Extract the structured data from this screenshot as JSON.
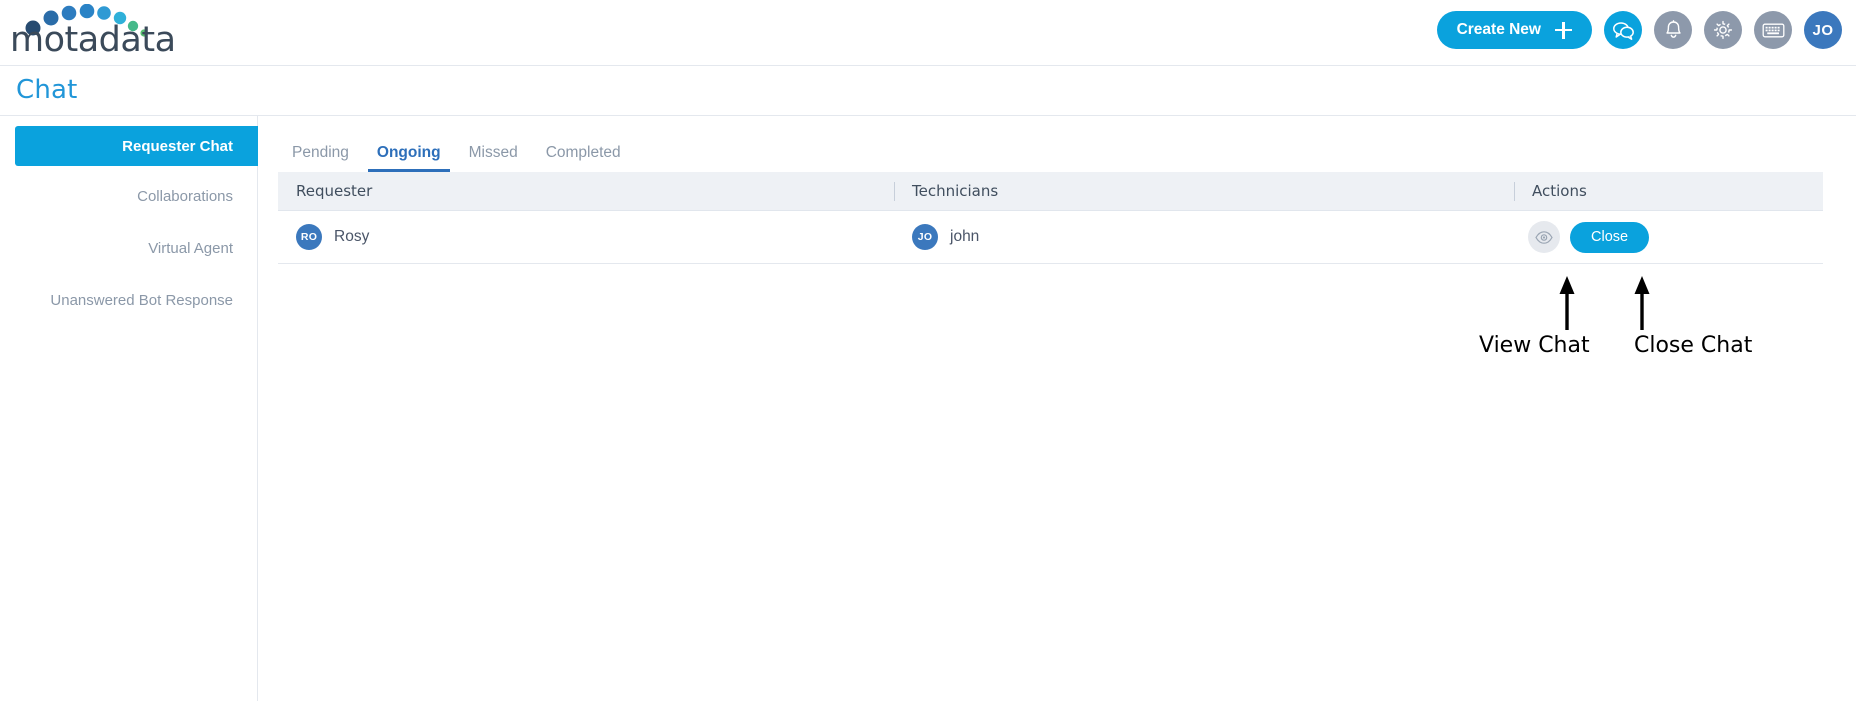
{
  "brand": {
    "logo_text": "motadata",
    "accent_blue": "#0aa2dd",
    "tab_active_blue": "#2d6fba",
    "avatar_blue": "#3b78bd",
    "header_icon_gray": "#8d99ab"
  },
  "header": {
    "create_new_label": "Create New",
    "icons": [
      {
        "name": "chat-icon",
        "style": "blue"
      },
      {
        "name": "bell-icon",
        "style": "gray"
      },
      {
        "name": "gear-icon",
        "style": "gray"
      },
      {
        "name": "keyboard-icon",
        "style": "gray"
      }
    ],
    "avatar_initials": "JO"
  },
  "page": {
    "title": "Chat"
  },
  "sidebar": {
    "items": [
      {
        "label": "Requester Chat",
        "active": true
      },
      {
        "label": "Collaborations",
        "active": false
      },
      {
        "label": "Virtual Agent",
        "active": false
      },
      {
        "label": "Unanswered Bot Response",
        "active": false
      }
    ]
  },
  "tabs": [
    {
      "label": "Pending",
      "active": false
    },
    {
      "label": "Ongoing",
      "active": true
    },
    {
      "label": "Missed",
      "active": false
    },
    {
      "label": "Completed",
      "active": false
    }
  ],
  "table": {
    "columns": [
      "Requester",
      "Technicians",
      "Actions"
    ],
    "rows": [
      {
        "requester_initials": "RO",
        "requester_name": "Rosy",
        "technician_initials": "JO",
        "technician_name": "john",
        "view_icon": "eye-icon",
        "close_label": "Close"
      }
    ]
  },
  "annotations": [
    {
      "label": "View Chat"
    },
    {
      "label": "Close Chat"
    }
  ]
}
